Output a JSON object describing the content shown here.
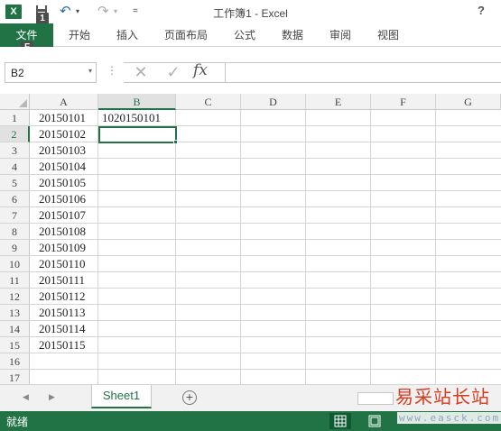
{
  "window": {
    "title": "工作簿1 - Excel",
    "help": "?",
    "logo_text": "X",
    "undo_icon": "↶",
    "redo_icon": "↷",
    "customize_icon": "=",
    "dropdown_glyph": "▾",
    "keytips": {
      "file": "F",
      "save": "1"
    }
  },
  "ribbon": {
    "tabs": [
      {
        "label": "文件"
      },
      {
        "label": "开始"
      },
      {
        "label": "插入"
      },
      {
        "label": "页面布局"
      },
      {
        "label": "公式"
      },
      {
        "label": "数据"
      },
      {
        "label": "审阅"
      },
      {
        "label": "视图"
      }
    ]
  },
  "formula_bar": {
    "name_box": "B2",
    "name_box_arrow": "▾",
    "separator": "⋮",
    "cancel_glyph": "✕",
    "enter_glyph": "✓",
    "fx_label": "fx",
    "formula": ""
  },
  "grid": {
    "columns": [
      "A",
      "B",
      "C",
      "D",
      "E",
      "F",
      "G"
    ],
    "rows": [
      "1",
      "2",
      "3",
      "4",
      "5",
      "6",
      "7",
      "8",
      "9",
      "10",
      "11",
      "12",
      "13",
      "14",
      "15",
      "16",
      "17"
    ],
    "column_a": [
      "20150101",
      "20150102",
      "20150103",
      "20150104",
      "20150105",
      "20150106",
      "20150107",
      "20150108",
      "20150109",
      "20150110",
      "20150111",
      "20150112",
      "20150113",
      "20150114",
      "20150115"
    ],
    "b1": "1020150101",
    "active_cell": "B2"
  },
  "sheets": {
    "tabs": [
      "Sheet1"
    ],
    "prev_glyph": "◀",
    "next_glyph": "▶",
    "add_glyph": "+"
  },
  "status": {
    "text": "就绪"
  },
  "watermark": {
    "cn": "易采站长站",
    "url": "www.easck.com"
  },
  "colors": {
    "accent": "#217346",
    "watermark_red": "#d83a1e"
  }
}
